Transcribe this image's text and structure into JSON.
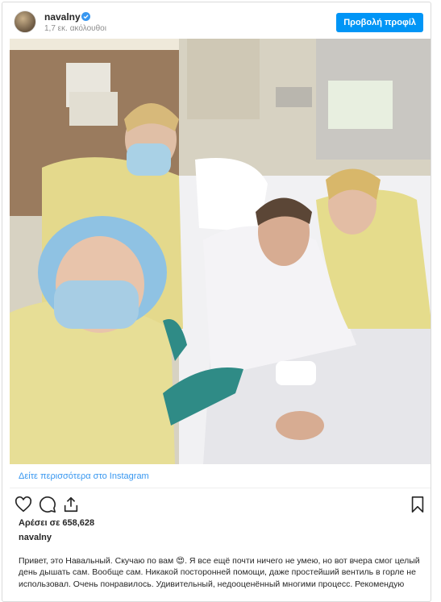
{
  "header": {
    "username": "navalny",
    "followers": "1,7 εκ. ακόλουθοι",
    "profile_button": "Προβολή προφίλ"
  },
  "post": {
    "more_link": "Δείτε περισσότερα στο Instagram",
    "likes": "Αρέσει σε 658,628",
    "caption_user": "navalny",
    "caption": "Привет, это Навальный. Скучаю по вам 😍. Я все ещё почти ничего не умею, но вот вчера смог целый день дышать сам. Вообще сам. Никакой посторонней помощи, даже простейший вентиль в горле не использовал. Очень понравилось. Удивительный, недооценённый многими процесс. Рекомендую"
  },
  "colors": {
    "accent": "#0095f6",
    "link": "#3897f0",
    "muted": "#8e8e8e",
    "border": "#dbdbdb"
  },
  "icons": [
    "verified-badge-icon",
    "heart-icon",
    "comment-icon",
    "share-icon",
    "bookmark-icon"
  ]
}
